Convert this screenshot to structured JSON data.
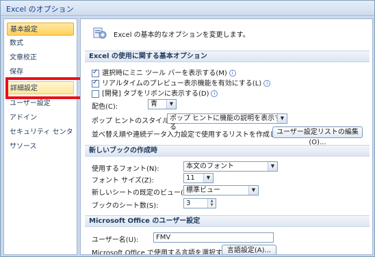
{
  "window": {
    "title": "Excel のオプション"
  },
  "sidebar": {
    "items": [
      {
        "label": "基本設定"
      },
      {
        "label": "数式"
      },
      {
        "label": "文章校正"
      },
      {
        "label": "保存"
      },
      {
        "label": "詳細設定"
      },
      {
        "label": "ユーザー設定"
      },
      {
        "label": "アドイン"
      },
      {
        "label": "セキュリティ センター"
      },
      {
        "label": "リソース"
      }
    ],
    "active_index": 0,
    "highlighted_index": 4
  },
  "header": {
    "text": "Excel の基本的なオプションを変更します。"
  },
  "sections": {
    "basic": {
      "title": "Excel の使用に関する基本オプション",
      "chk_minitoolbar": "選択時にミニ ツール バーを表示する(M)",
      "chk_livepreview": "リアルタイムのプレビュー表示機能を有効にする(L)",
      "chk_devtab": "[開発] タブをリボンに表示する(D)",
      "color_label": "配色(C):",
      "color_value": "青",
      "tip_label": "ポップ ヒントのスタイル(R):",
      "tip_value": "ポップ ヒントに機能の説明を表示する",
      "sortlist_label": "並べ替え順や連続データ入力設定で使用するリストを作成します:",
      "sortlist_button": "ユーザー設定リストの編集(O)..."
    },
    "newbook": {
      "title": "新しいブックの作成時",
      "font_label": "使用するフォント(N):",
      "font_value": "本文のフォント",
      "size_label": "フォント サイズ(Z):",
      "size_value": "11",
      "view_label": "新しいシートの既定のビュー(V):",
      "view_value": "標準ビュー",
      "sheets_label": "ブックのシート数(S):",
      "sheets_value": "3"
    },
    "user": {
      "title": "Microsoft Office のユーザー設定",
      "username_label": "ユーザー名(U):",
      "username_value": "FMV",
      "lang_label": "Microsoft Office で使用する言語を選択する",
      "lang_button": "言語設定(A)..."
    }
  },
  "checkbox_states": {
    "minitoolbar": true,
    "livepreview": true,
    "devtab": false
  },
  "colors": {
    "highlight_frame": "#e8101a",
    "active_nav": "#ffd25a"
  },
  "icons": {
    "header": "options-gear-icon",
    "info": "info-icon"
  }
}
